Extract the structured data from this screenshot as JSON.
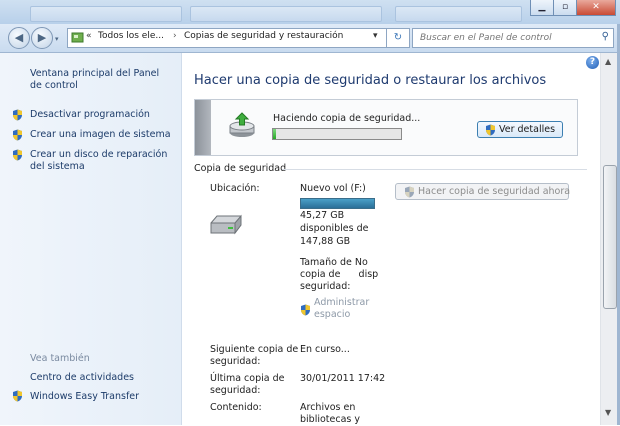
{
  "nav": {
    "back_icon": "back-arrow-icon",
    "forward_icon": "forward-arrow-icon",
    "breadcrumb_overflow": "«",
    "breadcrumb": [
      "Todos los ele...",
      "Copias de seguridad y restauración"
    ],
    "breadcrumb_sep": "›",
    "dropdown_icon": "▾",
    "refresh_icon": "↻",
    "search_placeholder": "Buscar en el Panel de control"
  },
  "sidebar": {
    "home_link": "Ventana principal del Panel de control",
    "tasks": [
      "Desactivar programación",
      "Crear una imagen de sistema",
      "Crear un disco de reparación del sistema"
    ],
    "see_also_label": "Vea también",
    "see_also": [
      "Centro de actividades",
      "Windows Easy Transfer"
    ]
  },
  "main": {
    "title": "Hacer una copia de seguridad o restaurar los archivos",
    "progress_text": "Haciendo copia de seguridad...",
    "progress_fraction": 0.02,
    "details_button": "Ver detalles",
    "section_title": "Copia de seguridad",
    "location_label": "Ubicación:",
    "drive_name": "Nuevo vol (F:)",
    "drive_used_fraction": 1.0,
    "free_line1": "45,27 GB",
    "free_line2": "disponibles de",
    "free_line3": "147,88 GB",
    "size_line1": "Tamaño de No",
    "size_line2": "copia de      disp",
    "size_line3": "seguridad:",
    "manage_line1": "Administrar",
    "manage_line2": "espacio",
    "backup_now_button": "Hacer copia de seguridad ahora",
    "next_label_1": "Siguiente copia de",
    "next_label_2": "seguridad:",
    "next_value": "En curso...",
    "last_label_1": "Última copia de",
    "last_label_2": "seguridad:",
    "last_value": "30/01/2011 17:42",
    "contents_label": "Contenido:",
    "contents_value_1": "Archivos en",
    "contents_value_2": "bibliotecas y"
  },
  "help_icon": "?"
}
